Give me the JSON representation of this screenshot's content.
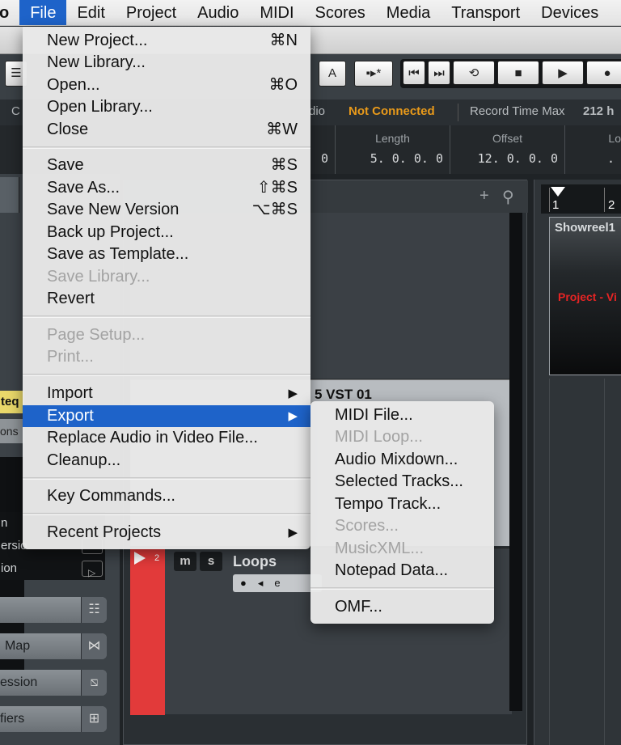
{
  "menubar": {
    "items": [
      "o",
      "File",
      "Edit",
      "Project",
      "Audio",
      "MIDI",
      "Scores",
      "Media",
      "Transport",
      "Devices"
    ],
    "active_index": 1
  },
  "toolbar": {
    "letter_button": "A",
    "snap_star": "*"
  },
  "status": {
    "audio_label": "dio",
    "connection": "Not Connected",
    "record_time_label": "Record Time Max",
    "record_time_value": "212 h"
  },
  "info_line": {
    "first_value": "0",
    "length_label": "Length",
    "length_value": "5. 0. 0.   0",
    "offset_label": "Offset",
    "offset_value": "12. 0. 0.   0",
    "fourth_label": "Lo",
    "fourth_value": "."
  },
  "inspector": {
    "eq_label": "teq",
    "section_label": "ons",
    "rows": [
      "n",
      "ersio",
      "ion"
    ],
    "pills": [
      "",
      "Map",
      "ession",
      "fiers"
    ],
    "accent": "#e9d86a"
  },
  "tracklist": {
    "add_glyph": "+",
    "instrument_track": "5 VST 01",
    "loops_track": {
      "number": "2",
      "mute": "m",
      "solo": "s",
      "name": "Loops",
      "color": "#e23a3a"
    }
  },
  "project": {
    "ruler_marks": [
      "1",
      "2"
    ],
    "clip_title": "Showreel1",
    "clip_label": "Project - Vi",
    "clip_label_color": "#e62424"
  },
  "file_menu": {
    "groups": [
      [
        {
          "label": "New Project...",
          "shortcut": "⌘N"
        },
        {
          "label": "New Library...",
          "shortcut": ""
        },
        {
          "label": "Open...",
          "shortcut": "⌘O"
        },
        {
          "label": "Open Library...",
          "shortcut": ""
        },
        {
          "label": "Close",
          "shortcut": "⌘W"
        }
      ],
      [
        {
          "label": "Save",
          "shortcut": "⌘S"
        },
        {
          "label": "Save As...",
          "shortcut": "⇧⌘S"
        },
        {
          "label": "Save New Version",
          "shortcut": "⌥⌘S"
        },
        {
          "label": "Back up Project...",
          "shortcut": ""
        },
        {
          "label": "Save as Template...",
          "shortcut": ""
        },
        {
          "label": "Save Library...",
          "shortcut": "",
          "disabled": true
        },
        {
          "label": "Revert",
          "shortcut": ""
        }
      ],
      [
        {
          "label": "Page Setup...",
          "shortcut": "",
          "disabled": true
        },
        {
          "label": "Print...",
          "shortcut": "",
          "disabled": true
        }
      ],
      [
        {
          "label": "Import",
          "submenu": true
        },
        {
          "label": "Export",
          "submenu": true,
          "active": true
        },
        {
          "label": "Replace Audio in Video File...",
          "shortcut": ""
        },
        {
          "label": "Cleanup...",
          "shortcut": ""
        }
      ],
      [
        {
          "label": "Key Commands...",
          "shortcut": ""
        }
      ],
      [
        {
          "label": "Recent Projects",
          "submenu": true
        }
      ]
    ]
  },
  "export_menu": {
    "groups": [
      [
        {
          "label": "MIDI File..."
        },
        {
          "label": "MIDI Loop...",
          "disabled": true
        },
        {
          "label": "Audio Mixdown..."
        },
        {
          "label": "Selected Tracks..."
        },
        {
          "label": "Tempo Track..."
        },
        {
          "label": "Scores...",
          "disabled": true
        },
        {
          "label": "MusicXML...",
          "disabled": true
        },
        {
          "label": "Notepad Data..."
        }
      ],
      [
        {
          "label": "OMF..."
        }
      ]
    ]
  },
  "colors": {
    "highlight": "#1e63c9",
    "status_warning": "#e99a1a"
  }
}
